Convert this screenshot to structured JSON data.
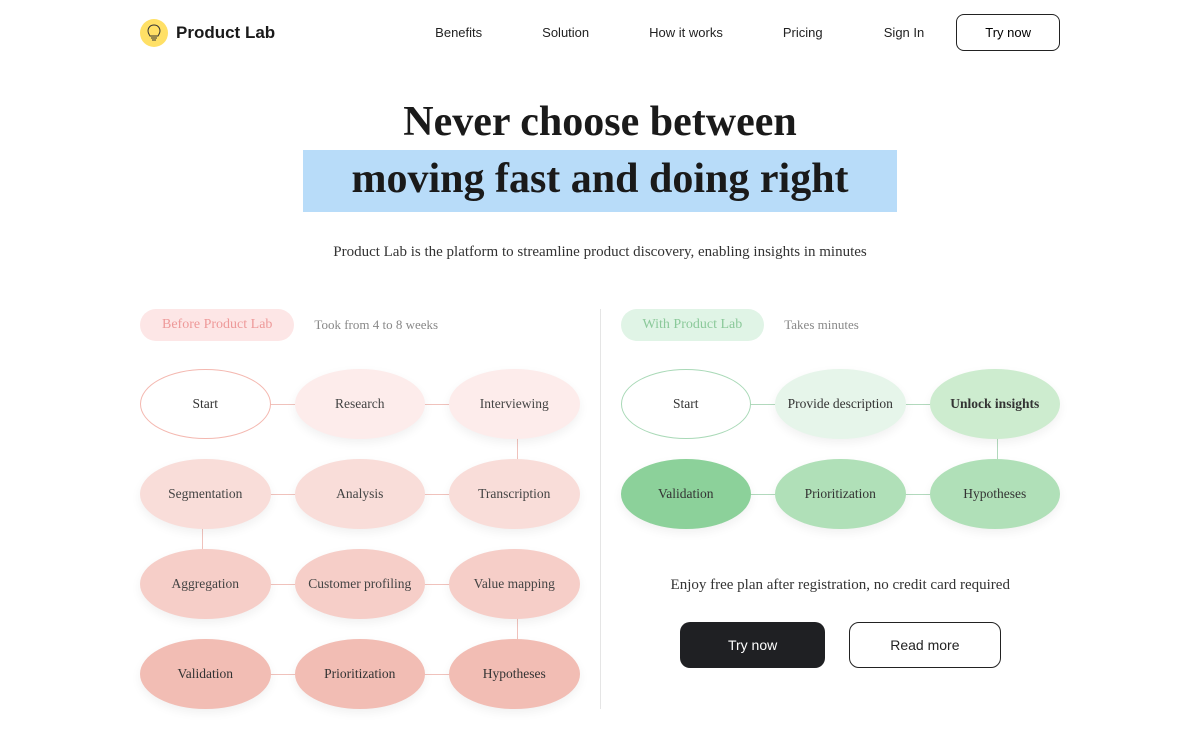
{
  "brand": {
    "name": "Product Lab"
  },
  "nav": {
    "benefits": "Benefits",
    "solution": "Solution",
    "how": "How it works",
    "pricing": "Pricing"
  },
  "header_actions": {
    "signin": "Sign In",
    "try_now": "Try now"
  },
  "hero": {
    "line1": "Never choose between",
    "line2": "moving fast and doing right",
    "subtitle": "Product Lab is the platform to streamline product discovery, enabling insights in minutes"
  },
  "before": {
    "label": "Before Product Lab",
    "time": "Took from 4 to 8 weeks",
    "steps": {
      "r1c1": "Start",
      "r1c2": "Research",
      "r1c3": "Interviewing",
      "r2c1": "Segmentation",
      "r2c2": "Analysis",
      "r2c3": "Transcription",
      "r3c1": "Aggregation",
      "r3c2": "Customer profiling",
      "r3c3": "Value mapping",
      "r4c1": "Validation",
      "r4c2": "Prioritization",
      "r4c3": "Hypotheses"
    }
  },
  "after": {
    "label": "With Product Lab",
    "time": "Takes minutes",
    "steps": {
      "r1c1": "Start",
      "r1c2": "Provide description",
      "r1c3": "Unlock insights",
      "r2c1": "Validation",
      "r2c2": "Prioritization",
      "r2c3": "Hypotheses"
    }
  },
  "cta": {
    "text": "Enjoy free plan after registration, no credit card required",
    "try_now": "Try now",
    "read_more": "Read more"
  }
}
